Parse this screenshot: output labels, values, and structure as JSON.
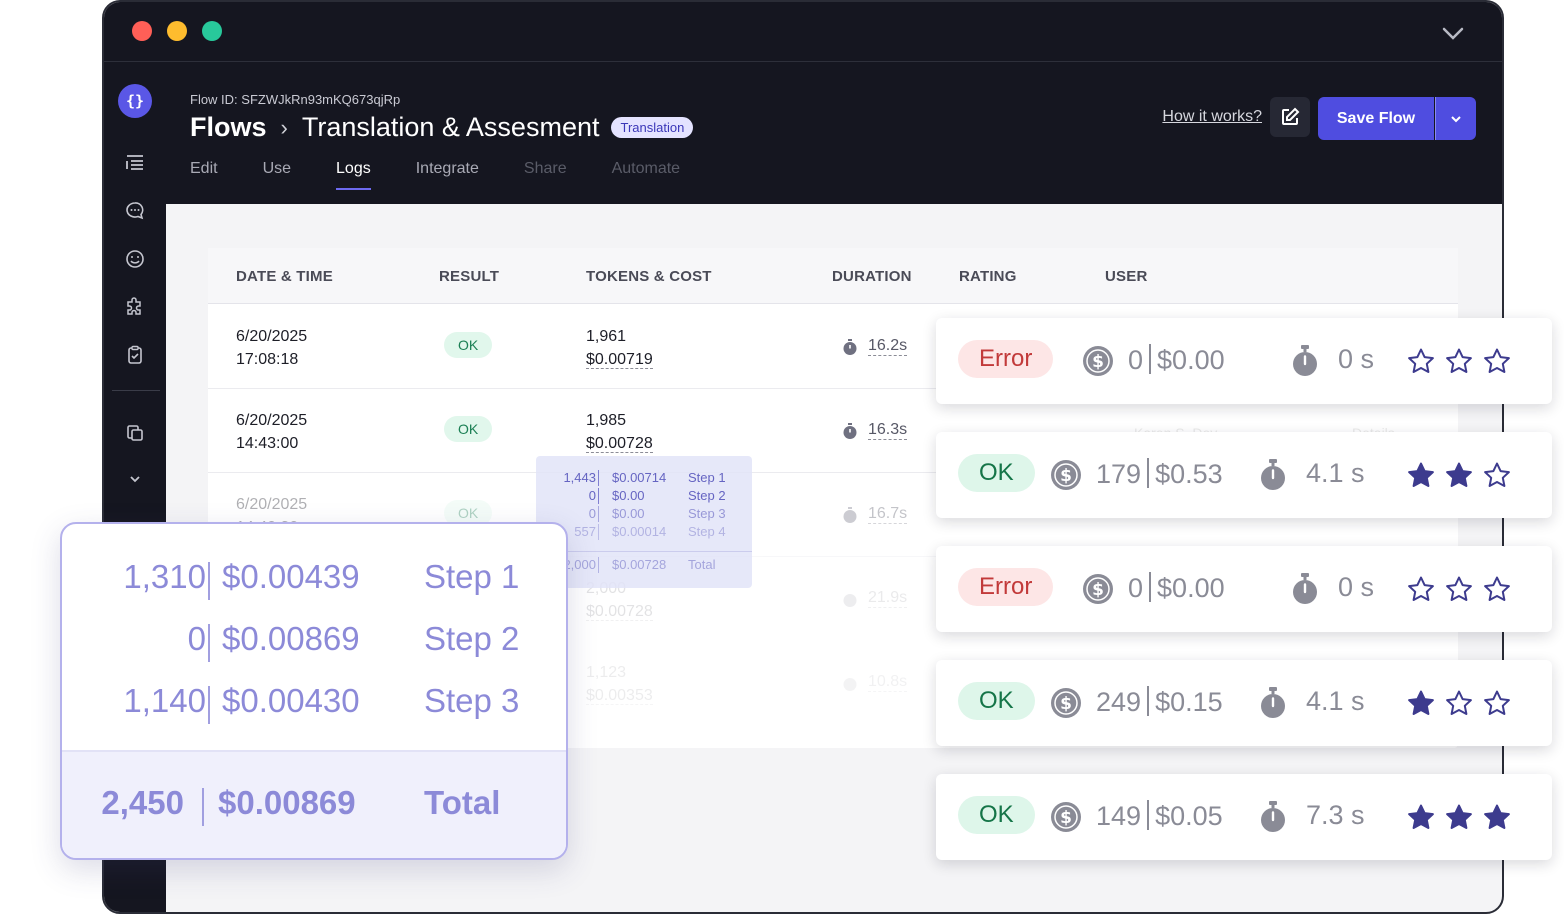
{
  "header": {
    "flow_id": "Flow ID: SFZWJkRn93mKQ673qjRp",
    "root": "Flows",
    "title": "Translation & Assesment",
    "tag": "Translation",
    "how_link": "How it works?",
    "save_label": "Save Flow",
    "tabs": [
      {
        "label": "Edit",
        "state": "normal"
      },
      {
        "label": "Use",
        "state": "normal"
      },
      {
        "label": "Logs",
        "state": "active"
      },
      {
        "label": "Integrate",
        "state": "normal"
      },
      {
        "label": "Share",
        "state": "disabled"
      },
      {
        "label": "Automate",
        "state": "disabled"
      }
    ]
  },
  "table": {
    "columns": [
      "DATE & TIME",
      "RESULT",
      "TOKENS & COST",
      "DURATION",
      "RATING",
      "USER"
    ],
    "rows": [
      {
        "date": "6/20/2025",
        "time": "17:08:18",
        "result": "OK",
        "tokens": "1,961",
        "cost": "$0.00719",
        "duration": "16.2s"
      },
      {
        "date": "6/20/2025",
        "time": "14:43:00",
        "result": "OK",
        "tokens": "1,985",
        "cost": "$0.00728",
        "duration": "16.3s"
      },
      {
        "date": "6/20/2025",
        "time": "14:40:30",
        "result": "OK",
        "tokens": "",
        "cost": "",
        "duration": "16.7s"
      },
      {
        "date": "",
        "time": "",
        "result": "",
        "tokens": "2,000",
        "cost": "$0.00728",
        "duration": "21.9s"
      },
      {
        "date": "",
        "time": "",
        "result": "",
        "tokens": "1,123",
        "cost": "$0.00353",
        "duration": "10.8s"
      }
    ],
    "ghost_user": "Karen S. Dev",
    "ghost_details": "Details"
  },
  "tooltip_small": {
    "lines": [
      {
        "tokens": "1,443",
        "cost": "$0.00714",
        "step": "Step 1"
      },
      {
        "tokens": "0",
        "cost": "$0.00",
        "step": "Step 2"
      },
      {
        "tokens": "0",
        "cost": "$0.00",
        "step": "Step 3"
      },
      {
        "tokens": "557",
        "cost": "$0.00014",
        "step": "Step 4"
      }
    ],
    "total": {
      "tokens": "2,000",
      "cost": "$0.00728",
      "step": "Total"
    }
  },
  "tooltip_big": {
    "lines": [
      {
        "tokens": "1,310",
        "cost": "$0.00439",
        "step": "Step 1"
      },
      {
        "tokens": "0",
        "cost": "$0.00869",
        "step": "Step 2"
      },
      {
        "tokens": "1,140",
        "cost": "$0.00430",
        "step": "Step 3"
      }
    ],
    "total": {
      "tokens": "2,450",
      "cost": "$0.00869",
      "step": "Total"
    }
  },
  "cards": [
    {
      "result": "Error",
      "tokens": "0",
      "cost": "$0.00",
      "time": "0 s",
      "rating": 0
    },
    {
      "result": "OK",
      "tokens": "179",
      "cost": "$0.53",
      "time": "4.1 s",
      "rating": 2
    },
    {
      "result": "Error",
      "tokens": "0",
      "cost": "$0.00",
      "time": "0 s",
      "rating": 0
    },
    {
      "result": "OK",
      "tokens": "249",
      "cost": "$0.15",
      "time": "4.1 s",
      "rating": 1
    },
    {
      "result": "OK",
      "tokens": "149",
      "cost": "$0.05",
      "time": "7.3 s",
      "rating": 3
    }
  ],
  "colors": {
    "accent": "#4f4de0",
    "star": "#3d3b8e",
    "ok_bg": "#def6ea",
    "error_bg": "#fde6e6"
  },
  "icons": [
    "logo-icon",
    "list-icon",
    "chat-icon",
    "emoji-icon",
    "puzzle-icon",
    "clipboard-icon",
    "copy-icon",
    "chevron-down-icon",
    "edit-icon",
    "coin-icon",
    "stopwatch-icon",
    "star-icon"
  ]
}
